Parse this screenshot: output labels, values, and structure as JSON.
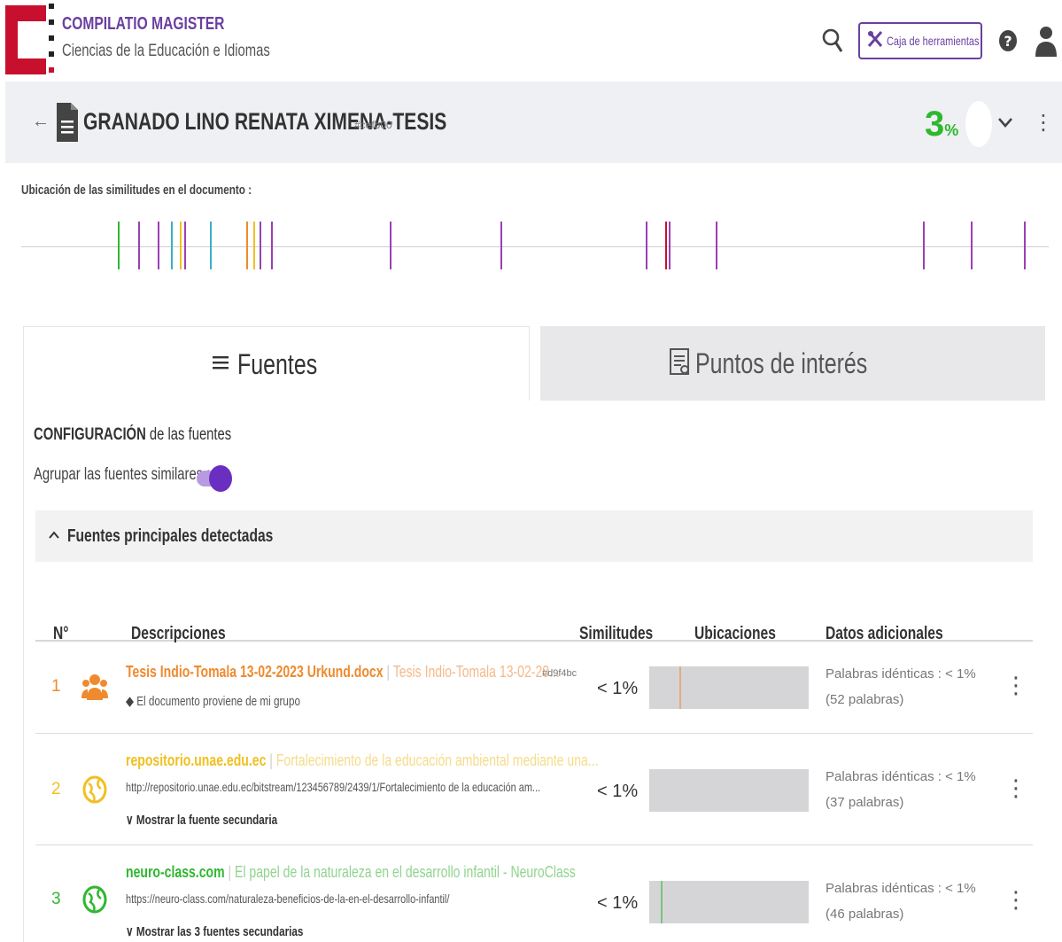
{
  "app": {
    "title": "COMPILATIO MAGISTER",
    "subtitle": "Ciencias de la Educación e Idiomas",
    "toolbox_label": "Caja de herramientas",
    "icons": [
      "search-icon",
      "toolbox-icon",
      "help-icon",
      "user-icon"
    ]
  },
  "document": {
    "title": "GRANADO LINO RENATA XIMENA-TESIS",
    "tag": "#cefb00",
    "similarity_value": "3",
    "similarity_unit": "%"
  },
  "locations": {
    "label": "Ubicación de las similitudes en el documento :",
    "marks": [
      {
        "pos": 0.094,
        "color": "#2eb82e"
      },
      {
        "pos": 0.114,
        "color": "#9b3fb5"
      },
      {
        "pos": 0.133,
        "color": "#9b3fb5"
      },
      {
        "pos": 0.146,
        "color": "#3ab0c8"
      },
      {
        "pos": 0.154,
        "color": "#f0c020"
      },
      {
        "pos": 0.159,
        "color": "#9b3fb5"
      },
      {
        "pos": 0.184,
        "color": "#3ab0c8"
      },
      {
        "pos": 0.219,
        "color": "#f08a2e"
      },
      {
        "pos": 0.226,
        "color": "#f0c020"
      },
      {
        "pos": 0.232,
        "color": "#9b3fb5"
      },
      {
        "pos": 0.243,
        "color": "#9b3fb5"
      },
      {
        "pos": 0.359,
        "color": "#9b3fb5"
      },
      {
        "pos": 0.466,
        "color": "#9b3fb5"
      },
      {
        "pos": 0.608,
        "color": "#9b3fb5"
      },
      {
        "pos": 0.627,
        "color": "#c8102e"
      },
      {
        "pos": 0.63,
        "color": "#9b3fb5"
      },
      {
        "pos": 0.676,
        "color": "#9b3fb5"
      },
      {
        "pos": 0.878,
        "color": "#9b3fb5"
      },
      {
        "pos": 0.924,
        "color": "#9b3fb5"
      },
      {
        "pos": 0.976,
        "color": "#9b3fb5"
      }
    ]
  },
  "tabs": {
    "sources": "Fuentes",
    "points": "Puntos de interés"
  },
  "config": {
    "title_bold": "CONFIGURACIÓN",
    "title_rest": " de las fuentes",
    "group_label": "Agrupar las fuentes similares :",
    "group_enabled": true
  },
  "section": {
    "title": "Fuentes principales detectadas",
    "columns": {
      "num": "N°",
      "desc": "Descripciones",
      "sim": "Similitudes",
      "loc": "Ubicaciones",
      "extra": "Datos adicionales"
    }
  },
  "rows": [
    {
      "num": "1",
      "color": "#f08a2e",
      "icon": "group-icon",
      "title_main": "Tesis Indio-Tomala 13-02-2023 Urkund.docx",
      "title_sep": " | ",
      "title_rest": "Tesis Indio-Tomala 13-02-20...",
      "tag": "#d9f4bc",
      "line2": "El documento proviene de mi grupo",
      "line3": "",
      "similarity": "< 1%",
      "extra": "Palabras idénticas : < 1% (52 palabras)",
      "marks": [
        0.19
      ]
    },
    {
      "num": "2",
      "color": "#f0c020",
      "icon": "globe-icon",
      "title_main": "repositorio.unae.edu.ec",
      "title_sep": " | ",
      "title_rest": "Fortalecimiento de la educación ambiental mediante una...",
      "tag": "",
      "line2": "http://repositorio.unae.edu.ec/bitstream/123456789/2439/1/Fortalecimiento de la educación am...",
      "line3": "Mostrar la fuente secundaria",
      "similarity": "< 1%",
      "extra": "Palabras idénticas : < 1% (37 palabras)",
      "marks": []
    },
    {
      "num": "3",
      "color": "#2eb82e",
      "icon": "globe-icon",
      "title_main": "neuro-class.com",
      "title_sep": " | ",
      "title_rest": "El papel de la naturaleza en el desarrollo infantil - NeuroClass",
      "tag": "",
      "line2": "https://neuro-class.com/naturaleza-beneficios-de-la-en-el-desarrollo-infantil/",
      "line3": "Mostrar las 3 fuentes secundarias",
      "similarity": "< 1%",
      "extra": "Palabras idénticas : < 1% (46 palabras)",
      "marks": [
        0.07
      ]
    }
  ]
}
